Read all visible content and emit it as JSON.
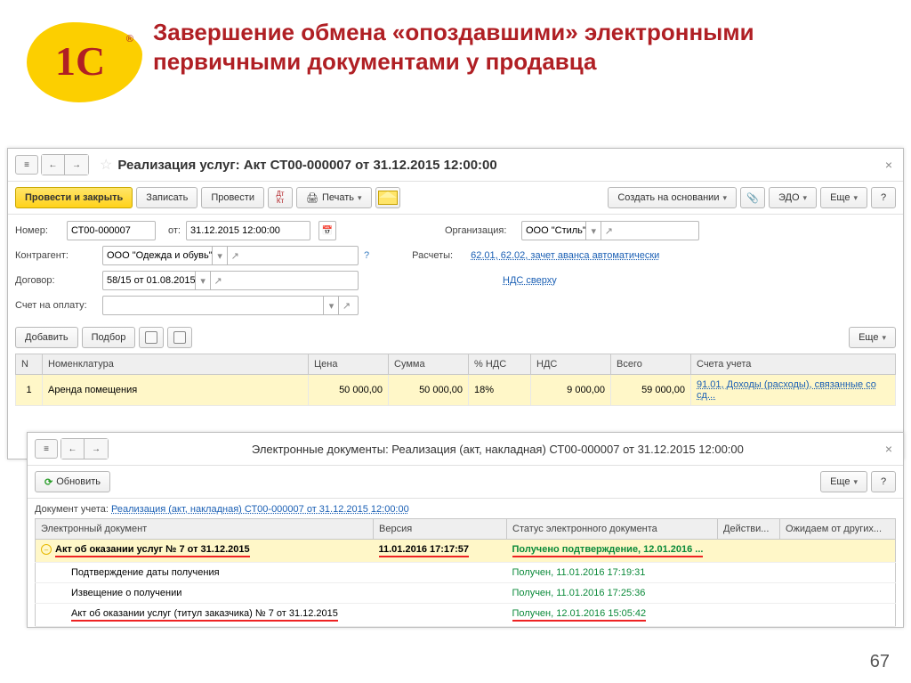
{
  "slide": {
    "logo_text": "1С",
    "title": "Завершение обмена «опоздавшими» электронными первичными документами у продавца",
    "page_num": "67"
  },
  "win1": {
    "title": "Реализация услуг: Акт СТ00-000007 от 31.12.2015 12:00:00",
    "toolbar": {
      "post_close": "Провести и закрыть",
      "save": "Записать",
      "post": "Провести",
      "print": "Печать",
      "create_basis": "Создать на основании",
      "edo": "ЭДО",
      "more": "Еще"
    },
    "fields": {
      "number_label": "Номер:",
      "number": "СТ00-000007",
      "date_label": "от:",
      "date": "31.12.2015 12:00:00",
      "org_label": "Организация:",
      "org": "ООО \"Стиль\"",
      "counterparty_label": "Контрагент:",
      "counterparty": "ООО \"Одежда и обувь\"",
      "settlements_label": "Расчеты:",
      "settlements": "62.01, 62.02, зачет аванса автоматически",
      "contract_label": "Договор:",
      "contract": "58/15 от 01.08.2015",
      "vat_link": "НДС сверху",
      "invoice_label": "Счет на оплату:"
    },
    "subtoolbar": {
      "add": "Добавить",
      "pick": "Подбор",
      "more": "Еще"
    },
    "table": {
      "headers": {
        "n": "N",
        "nom": "Номенклатура",
        "price": "Цена",
        "sum": "Сумма",
        "vat_pct": "% НДС",
        "vat": "НДС",
        "total": "Всего",
        "acct": "Счета учета"
      },
      "row": {
        "n": "1",
        "nom": "Аренда помещения",
        "price": "50 000,00",
        "sum": "50 000,00",
        "vat_pct": "18%",
        "vat": "9 000,00",
        "total": "59 000,00",
        "acct": "91.01, Доходы (расходы), связанные со сд..."
      }
    }
  },
  "win2": {
    "title": "Электронные документы: Реализация (акт, накладная) СТ00-000007 от 31.12.2015 12:00:00",
    "refresh": "Обновить",
    "more": "Еще",
    "doc_label": "Документ учета:",
    "doc_link": "Реализация (акт, накладная) СТ00-000007 от 31.12.2015 12:00:00",
    "headers": {
      "doc": "Электронный документ",
      "ver": "Версия",
      "status": "Статус электронного документа",
      "action": "Действи...",
      "wait": "Ожидаем от других..."
    },
    "rows": [
      {
        "doc": "Акт об оказании услуг № 7 от 31.12.2015",
        "ver": "11.01.2016 17:17:57",
        "status": "Получено подтверждение, 12.01.2016 ...",
        "hl": true,
        "ru": true
      },
      {
        "doc": "Подтверждение даты получения",
        "ver": "",
        "status": "Получен, 11.01.2016 17:19:31",
        "indent": true
      },
      {
        "doc": "Извещение о получении",
        "ver": "",
        "status": "Получен, 11.01.2016 17:25:36",
        "indent": true
      },
      {
        "doc": "Акт об оказании услуг (титул заказчика) № 7 от 31.12.2015",
        "ver": "",
        "status": "Получен, 12.01.2016 15:05:42",
        "indent": true,
        "ru": true
      }
    ]
  }
}
